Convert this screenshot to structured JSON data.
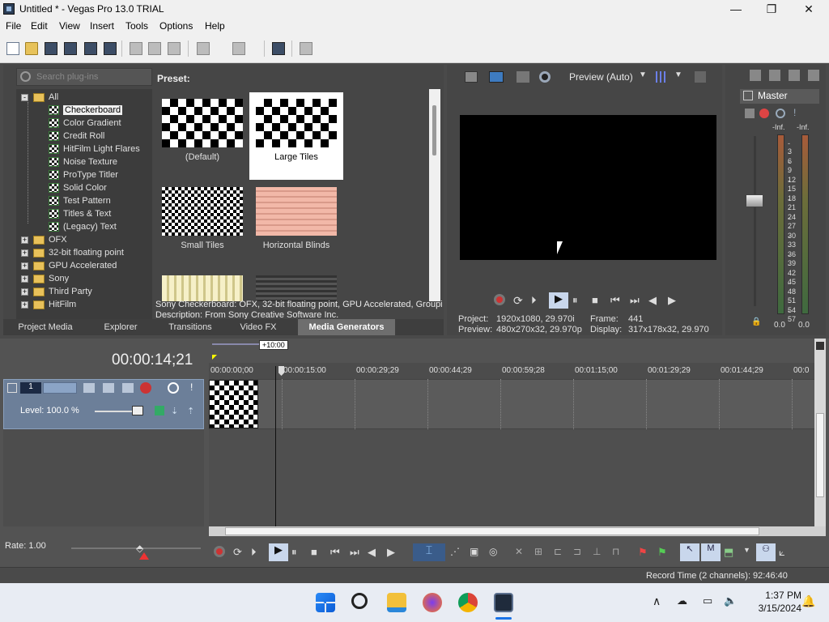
{
  "window": {
    "title": "Untitled * - Vegas Pro 13.0 TRIAL",
    "minimize": "—",
    "maximize": "❐",
    "close": "✕"
  },
  "menu": [
    "File",
    "Edit",
    "View",
    "Insert",
    "Tools",
    "Options",
    "Help"
  ],
  "plugins": {
    "search_placeholder": "Search plug-ins",
    "tree": [
      {
        "label": "All",
        "type": "folder",
        "expanded": true
      },
      {
        "label": "Checkerboard",
        "type": "plugin",
        "selected": true
      },
      {
        "label": "Color Gradient",
        "type": "plugin"
      },
      {
        "label": "Credit Roll",
        "type": "plugin"
      },
      {
        "label": "HitFilm Light Flares",
        "type": "plugin"
      },
      {
        "label": "Noise Texture",
        "type": "plugin"
      },
      {
        "label": "ProType Titler",
        "type": "plugin"
      },
      {
        "label": "Solid Color",
        "type": "plugin"
      },
      {
        "label": "Test Pattern",
        "type": "plugin"
      },
      {
        "label": "Titles & Text",
        "type": "plugin"
      },
      {
        "label": "(Legacy) Text",
        "type": "plugin"
      },
      {
        "label": "OFX",
        "type": "folder"
      },
      {
        "label": "32-bit floating point",
        "type": "folder"
      },
      {
        "label": "GPU Accelerated",
        "type": "folder"
      },
      {
        "label": "Sony",
        "type": "folder"
      },
      {
        "label": "Third Party",
        "type": "folder"
      },
      {
        "label": "HitFilm",
        "type": "folder"
      }
    ],
    "preset_label": "Preset:",
    "presets": [
      {
        "label": "(Default)"
      },
      {
        "label": "Large Tiles",
        "selected": true
      },
      {
        "label": "Small Tiles"
      },
      {
        "label": "Horizontal Blinds"
      }
    ],
    "description_line1": "Sony Checkerboard: OFX, 32-bit floating point, GPU Accelerated, Groupi",
    "description_line2": "Description: From Sony Creative Software Inc."
  },
  "tabs": [
    {
      "label": "Project Media"
    },
    {
      "label": "Explorer"
    },
    {
      "label": "Transitions"
    },
    {
      "label": "Video FX"
    },
    {
      "label": "Media Generators",
      "active": true
    }
  ],
  "preview": {
    "mode": "Preview (Auto)",
    "project_label": "Project:",
    "project_value": "1920x1080, 29.970i",
    "preview_label": "Preview:",
    "preview_value": "480x270x32, 29.970p",
    "frame_label": "Frame:",
    "frame_value": "441",
    "display_label": "Display:",
    "display_value": "317x178x32, 29.970"
  },
  "master": {
    "title": "Master",
    "left_peak": "-Inf.",
    "right_peak": "-Inf.",
    "scale": [
      "3",
      "6",
      "9",
      "12",
      "15",
      "18",
      "21",
      "24",
      "27",
      "30",
      "33",
      "36",
      "39",
      "42",
      "45",
      "48",
      "51",
      "54",
      "57"
    ],
    "left_level": "0.0",
    "right_level": "0.0"
  },
  "timeline": {
    "current_time": "00:00:14;21",
    "offset_badge": "+10:00",
    "ruler": [
      "00:00:00;00",
      "00:00:15:00",
      "00:00:29;29",
      "00:00:44;29",
      "00:00:59;28",
      "00:01:15;00",
      "00:01:29;29",
      "00:01:44;29",
      "00:0"
    ],
    "track_level": "Level: 100.0 %",
    "rate": "Rate: 1.00"
  },
  "status": {
    "record_time": "Record Time (2 channels): 92:46:40"
  },
  "taskbar": {
    "time": "1:37 PM",
    "date": "3/15/2024"
  },
  "colors": {
    "accent_selected_tab": "#6e6e6e",
    "track_header": "#6c7f99"
  }
}
